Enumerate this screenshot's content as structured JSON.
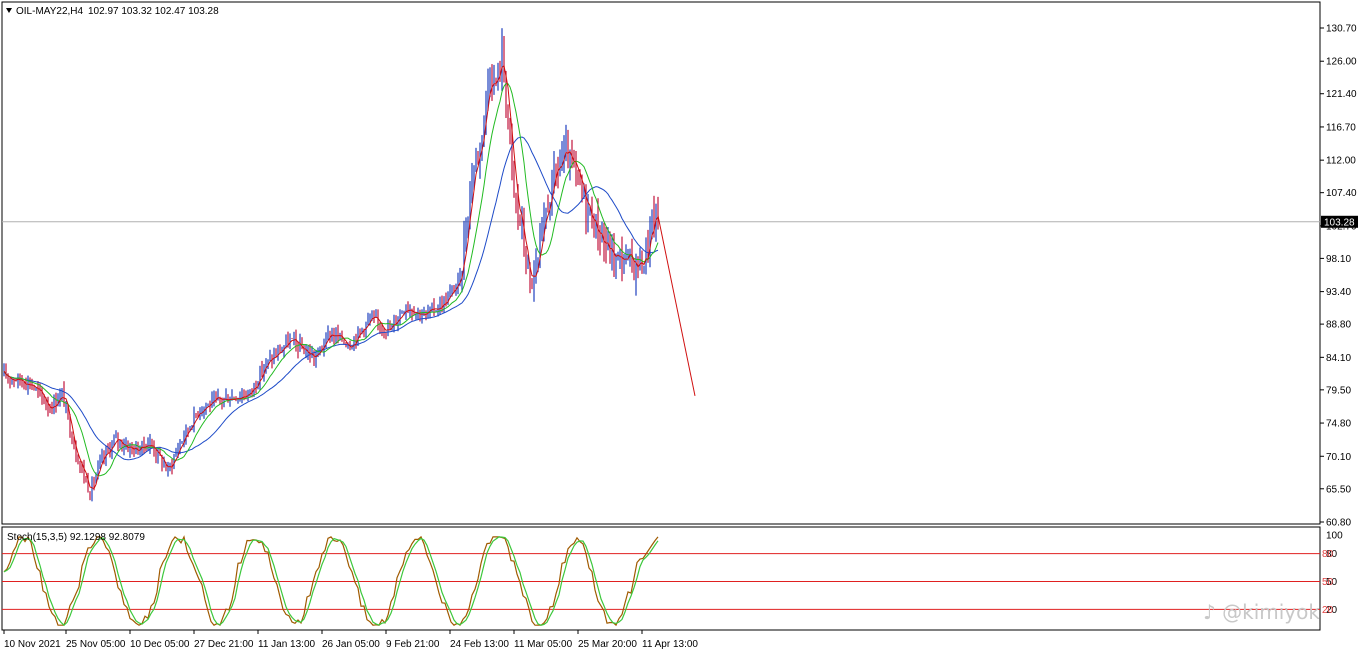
{
  "header": {
    "symbol_label": "OIL-MAY22,H4",
    "ohlc": "102.97 103.32 102.47 103.28"
  },
  "price_axis": {
    "ticks": [
      "130.70",
      "126.00",
      "121.40",
      "116.70",
      "112.00",
      "107.40",
      "102.70",
      "98.10",
      "93.40",
      "88.80",
      "84.10",
      "79.50",
      "74.80",
      "70.10",
      "65.50",
      "60.80"
    ],
    "current_price_label": "103.28"
  },
  "time_axis": {
    "labels": [
      "10 Nov 2021",
      "25 Nov 05:00",
      "10 Dec 05:00",
      "27 Dec 21:00",
      "11 Jan 13:00",
      "26 Jan 05:00",
      "9 Feb 21:00",
      "24 Feb 13:00",
      "11 Mar 05:00",
      "25 Mar 20:00",
      "11 Apr 13:00"
    ]
  },
  "stoch_panel": {
    "title": "Stoch(15,3,5) 92.1298 92.8079",
    "ticks": [
      "100",
      "80",
      "50",
      "20"
    ],
    "level_labels": [
      "80",
      "50",
      "20"
    ]
  },
  "watermark": "@kimiyok",
  "colors": {
    "bull_candle": "#1f3fbf",
    "bear_candle": "#c0143c",
    "ma_fast": "#d01010",
    "ma_mid": "#22bb22",
    "ma_slow": "#1e4bc8",
    "level_line": "#e02020",
    "stoch_main": "#a05a00",
    "stoch_signal": "#3cc83c",
    "projection": "#d01010"
  },
  "chart_data": {
    "type": "line",
    "title": "OIL-MAY22,H4",
    "ylim": [
      60.8,
      130.7
    ],
    "series": [
      {
        "name": "OIL-MAY22,H4",
        "x": [
          "10 Nov 2021",
          "25 Nov 05:00",
          "10 Dec 05:00",
          "27 Dec 21:00",
          "11 Jan 13:00",
          "26 Jan 05:00",
          "9 Feb 21:00",
          "24 Feb 13:00",
          "11 Mar 05:00",
          "25 Mar 20:00",
          "11 Apr 13:00"
        ],
        "values": [
          81.5,
          74.0,
          71.5,
          76.5,
          81.5,
          87.0,
          89.0,
          96.0,
          108.0,
          104.0,
          103.28
        ]
      }
    ],
    "projection": {
      "from": 103.28,
      "to": 79.5
    },
    "stochastic": {
      "main": 92.1298,
      "signal": 92.8079,
      "levels": [
        80,
        50,
        20
      ]
    }
  }
}
